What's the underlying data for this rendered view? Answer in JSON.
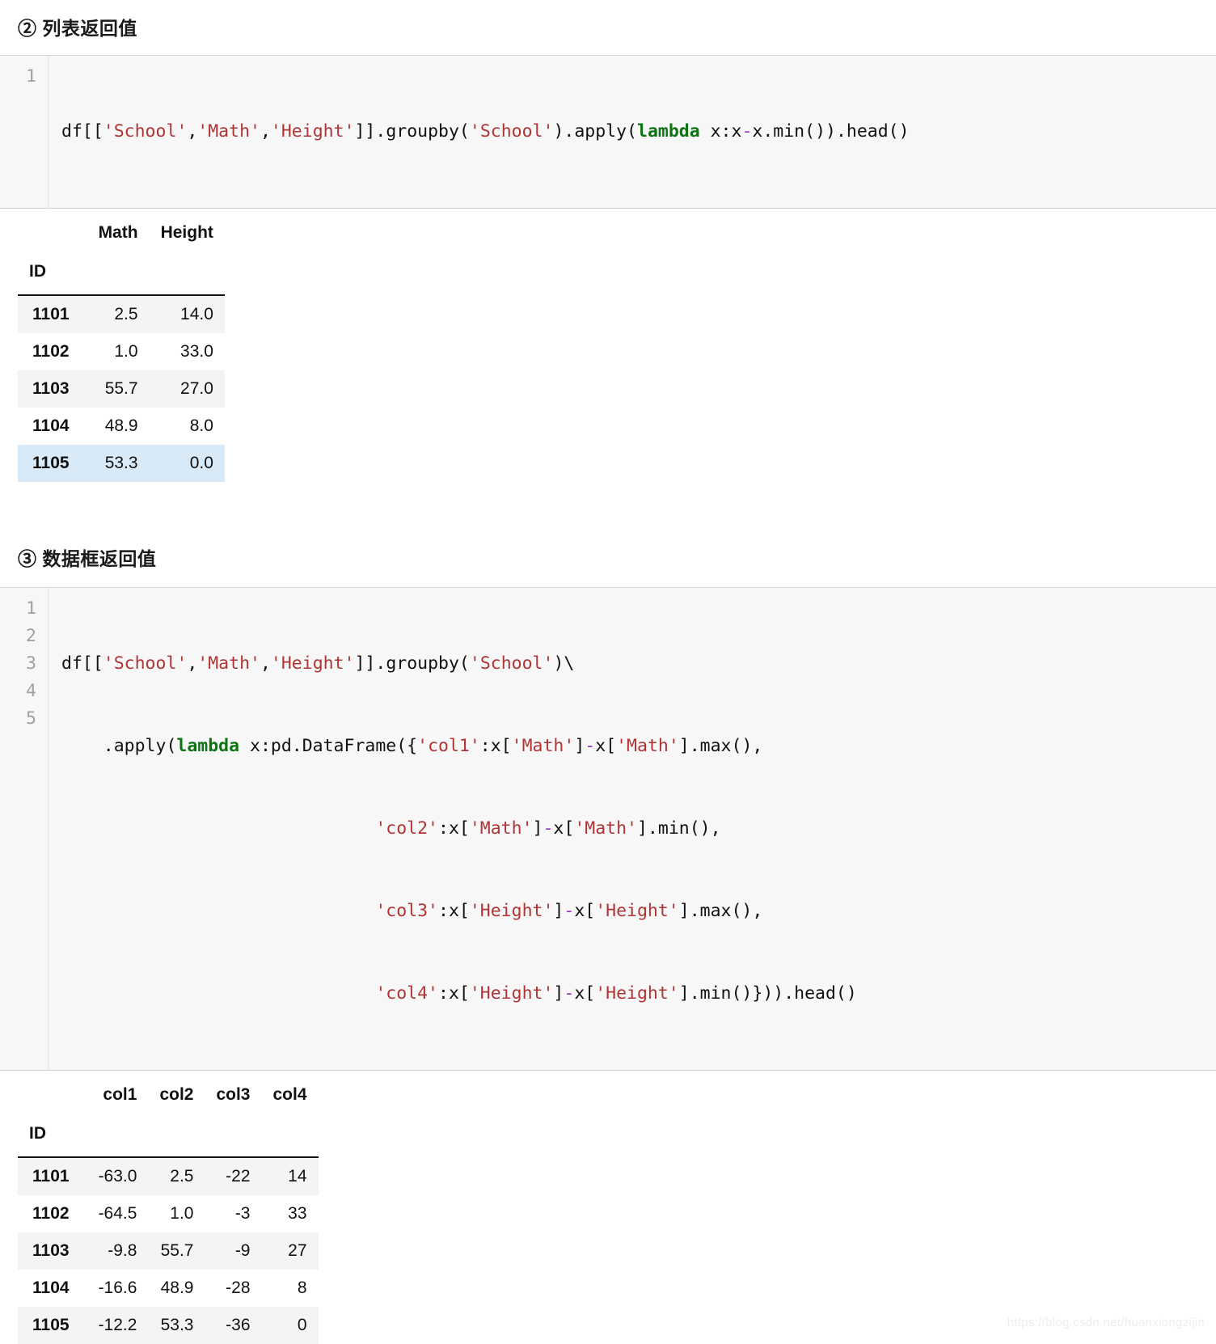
{
  "sections": [
    {
      "heading": "② 列表返回值",
      "code": {
        "lines": [
          {
            "number": "1",
            "tokens": [
              {
                "t": "df[[",
                "c": "plain"
              },
              {
                "t": "'School'",
                "c": "str"
              },
              {
                "t": ",",
                "c": "plain"
              },
              {
                "t": "'Math'",
                "c": "str"
              },
              {
                "t": ",",
                "c": "plain"
              },
              {
                "t": "'Height'",
                "c": "str"
              },
              {
                "t": "]].groupby(",
                "c": "plain"
              },
              {
                "t": "'School'",
                "c": "str"
              },
              {
                "t": ").apply(",
                "c": "plain"
              },
              {
                "t": "lambda",
                "c": "kw"
              },
              {
                "t": " x:x",
                "c": "plain"
              },
              {
                "t": "-",
                "c": "op"
              },
              {
                "t": "x.min()).head()",
                "c": "plain"
              }
            ]
          }
        ]
      },
      "table": {
        "columns": [
          "Math",
          "Height"
        ],
        "index_name": "ID",
        "rows": [
          {
            "index": "1101",
            "values": [
              "2.5",
              "14.0"
            ],
            "style": "odd"
          },
          {
            "index": "1102",
            "values": [
              "1.0",
              "33.0"
            ],
            "style": "even"
          },
          {
            "index": "1103",
            "values": [
              "55.7",
              "27.0"
            ],
            "style": "odd"
          },
          {
            "index": "1104",
            "values": [
              "48.9",
              "8.0"
            ],
            "style": "even"
          },
          {
            "index": "1105",
            "values": [
              "53.3",
              "0.0"
            ],
            "style": "hl"
          }
        ]
      }
    },
    {
      "heading": "③ 数据框返回值",
      "code": {
        "lines": [
          {
            "number": "1",
            "tokens": [
              {
                "t": "df[[",
                "c": "plain"
              },
              {
                "t": "'School'",
                "c": "str"
              },
              {
                "t": ",",
                "c": "plain"
              },
              {
                "t": "'Math'",
                "c": "str"
              },
              {
                "t": ",",
                "c": "plain"
              },
              {
                "t": "'Height'",
                "c": "str"
              },
              {
                "t": "]].groupby(",
                "c": "plain"
              },
              {
                "t": "'School'",
                "c": "str"
              },
              {
                "t": ")\\",
                "c": "plain"
              }
            ]
          },
          {
            "number": "2",
            "tokens": [
              {
                "t": "    .apply(",
                "c": "plain"
              },
              {
                "t": "lambda",
                "c": "kw"
              },
              {
                "t": " x:pd.DataFrame({",
                "c": "plain"
              },
              {
                "t": "'col1'",
                "c": "str"
              },
              {
                "t": ":x[",
                "c": "plain"
              },
              {
                "t": "'Math'",
                "c": "str"
              },
              {
                "t": "]",
                "c": "plain"
              },
              {
                "t": "-",
                "c": "op"
              },
              {
                "t": "x[",
                "c": "plain"
              },
              {
                "t": "'Math'",
                "c": "str"
              },
              {
                "t": "].max(),",
                "c": "plain"
              }
            ]
          },
          {
            "number": "3",
            "tokens": [
              {
                "t": "                              ",
                "c": "plain"
              },
              {
                "t": "'col2'",
                "c": "str"
              },
              {
                "t": ":x[",
                "c": "plain"
              },
              {
                "t": "'Math'",
                "c": "str"
              },
              {
                "t": "]",
                "c": "plain"
              },
              {
                "t": "-",
                "c": "op"
              },
              {
                "t": "x[",
                "c": "plain"
              },
              {
                "t": "'Math'",
                "c": "str"
              },
              {
                "t": "].min(),",
                "c": "plain"
              }
            ]
          },
          {
            "number": "4",
            "tokens": [
              {
                "t": "                              ",
                "c": "plain"
              },
              {
                "t": "'col3'",
                "c": "str"
              },
              {
                "t": ":x[",
                "c": "plain"
              },
              {
                "t": "'Height'",
                "c": "str"
              },
              {
                "t": "]",
                "c": "plain"
              },
              {
                "t": "-",
                "c": "op"
              },
              {
                "t": "x[",
                "c": "plain"
              },
              {
                "t": "'Height'",
                "c": "str"
              },
              {
                "t": "].max(),",
                "c": "plain"
              }
            ]
          },
          {
            "number": "5",
            "tokens": [
              {
                "t": "                              ",
                "c": "plain"
              },
              {
                "t": "'col4'",
                "c": "str"
              },
              {
                "t": ":x[",
                "c": "plain"
              },
              {
                "t": "'Height'",
                "c": "str"
              },
              {
                "t": "]",
                "c": "plain"
              },
              {
                "t": "-",
                "c": "op"
              },
              {
                "t": "x[",
                "c": "plain"
              },
              {
                "t": "'Height'",
                "c": "str"
              },
              {
                "t": "].min()})).head()",
                "c": "plain"
              }
            ]
          }
        ]
      },
      "table": {
        "columns": [
          "col1",
          "col2",
          "col3",
          "col4"
        ],
        "index_name": "ID",
        "rows": [
          {
            "index": "1101",
            "values": [
              "-63.0",
              "2.5",
              "-22",
              "14"
            ],
            "style": "odd"
          },
          {
            "index": "1102",
            "values": [
              "-64.5",
              "1.0",
              "-3",
              "33"
            ],
            "style": "even"
          },
          {
            "index": "1103",
            "values": [
              "-9.8",
              "55.7",
              "-9",
              "27"
            ],
            "style": "odd"
          },
          {
            "index": "1104",
            "values": [
              "-16.6",
              "48.9",
              "-28",
              "8"
            ],
            "style": "even"
          },
          {
            "index": "1105",
            "values": [
              "-12.2",
              "53.3",
              "-36",
              "0"
            ],
            "style": "odd"
          }
        ]
      }
    }
  ],
  "watermark": "https://blog.csdn.net/huanxiongzijin",
  "colors": {
    "code_background": "#f7f7f7",
    "string_token": "#b03434",
    "keyword_token": "#0d7413",
    "operator_token": "#9b30c9",
    "row_stripe": "#f4f4f4",
    "row_highlight": "#d8e9f7"
  }
}
